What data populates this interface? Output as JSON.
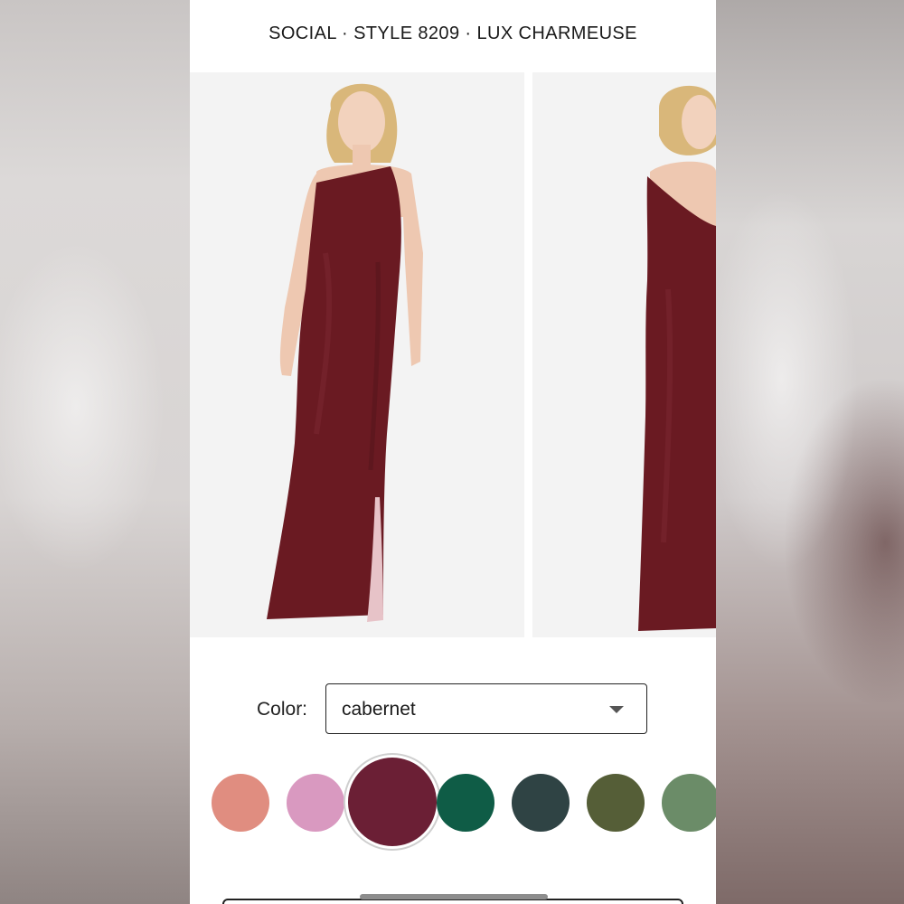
{
  "header": {
    "title": "SOCIAL · STYLE 8209 · LUX CHARMEUSE"
  },
  "product": {
    "dress_color": "#6a1a22",
    "images": [
      "front-view",
      "back-view"
    ]
  },
  "color_picker": {
    "label": "Color:",
    "selected_value": "cabernet",
    "swatches": [
      {
        "color": "#e08d80"
      },
      {
        "color": "#d999c0"
      },
      {
        "color": "#6b1f35",
        "selected": true
      },
      {
        "color": "#0f5c46"
      },
      {
        "color": "#2f4344"
      },
      {
        "color": "#555e37"
      },
      {
        "color": "#6b8c68"
      }
    ]
  }
}
